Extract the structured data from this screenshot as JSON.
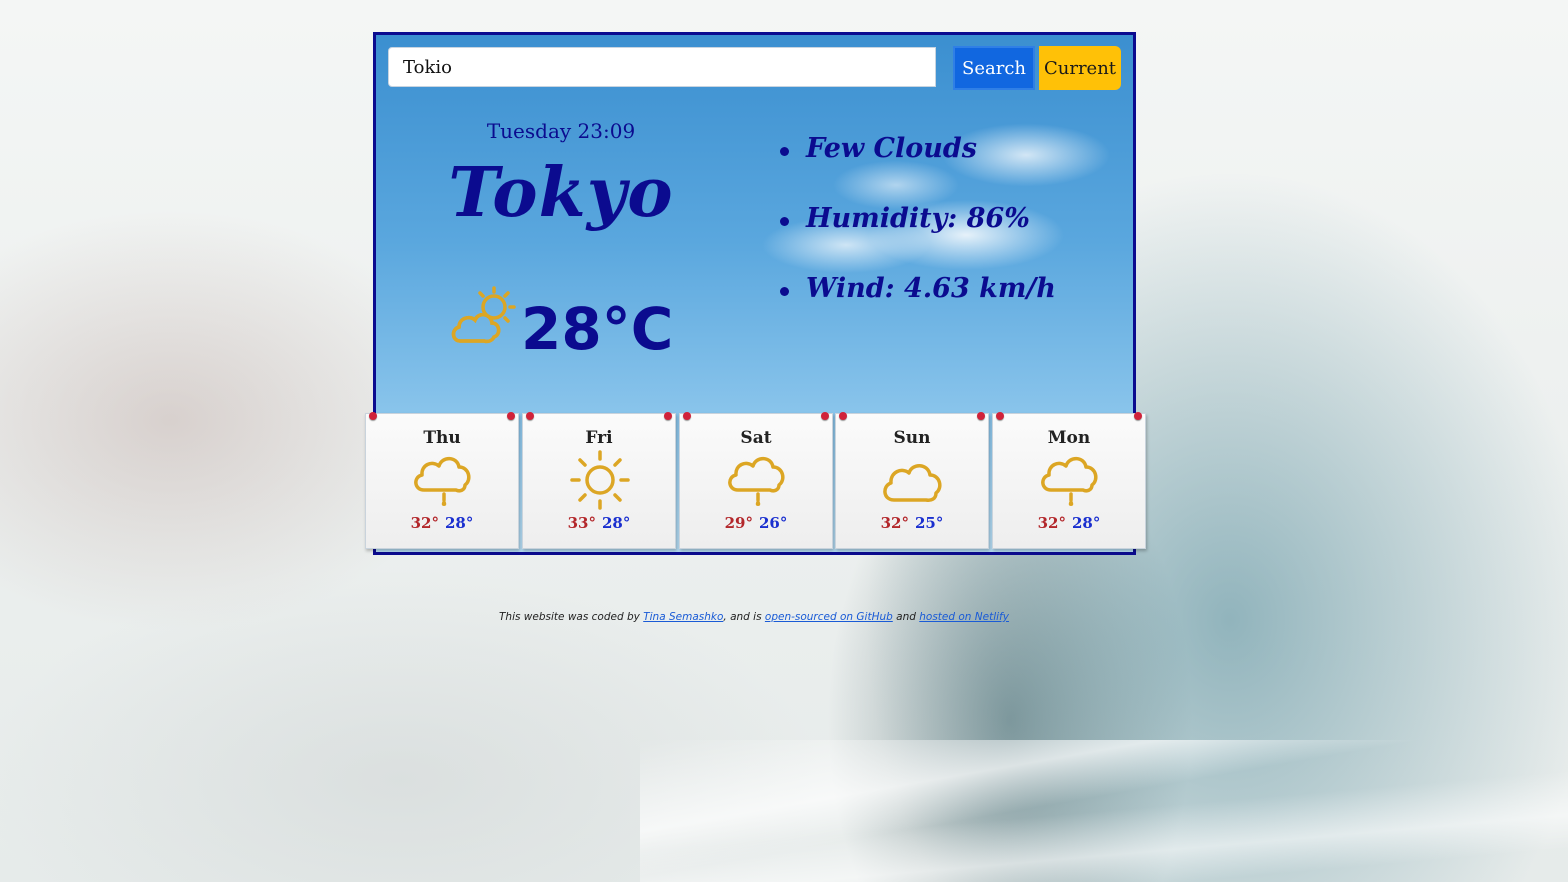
{
  "search": {
    "value": "Tokio",
    "search_label": "Search",
    "current_label": "Current"
  },
  "current": {
    "datetime": "Tuesday 23:09",
    "city": "Tokyo",
    "icon": "sun-behind-cloud-icon",
    "temperature": "28°C",
    "description": "Few Clouds",
    "humidity": "Humidity: 86%",
    "wind": "Wind: 4.63 km/h"
  },
  "forecast": [
    {
      "day": "Thu",
      "icon": "rain-cloud-icon",
      "high": "32°",
      "low": "28°"
    },
    {
      "day": "Fri",
      "icon": "sun-icon",
      "high": "33°",
      "low": "28°"
    },
    {
      "day": "Sat",
      "icon": "rain-cloud-icon",
      "high": "29°",
      "low": "26°"
    },
    {
      "day": "Sun",
      "icon": "cloud-icon",
      "high": "32°",
      "low": "25°"
    },
    {
      "day": "Mon",
      "icon": "rain-cloud-icon",
      "high": "32°",
      "low": "28°"
    }
  ],
  "footer": {
    "prefix": "This website was coded by",
    "author_link": "Tina Semashko",
    "middle": ", and is",
    "github_link": "open-sourced on GitHub",
    "and": "and",
    "netlify_link": "hosted on Netlify"
  },
  "colors": {
    "accent_navy": "#0b0b8f",
    "search_button": "#1167e0",
    "current_button": "#ffc107",
    "icon_gold": "#dca624",
    "high_temp": "#b3272b",
    "low_temp": "#1a2fcf"
  }
}
